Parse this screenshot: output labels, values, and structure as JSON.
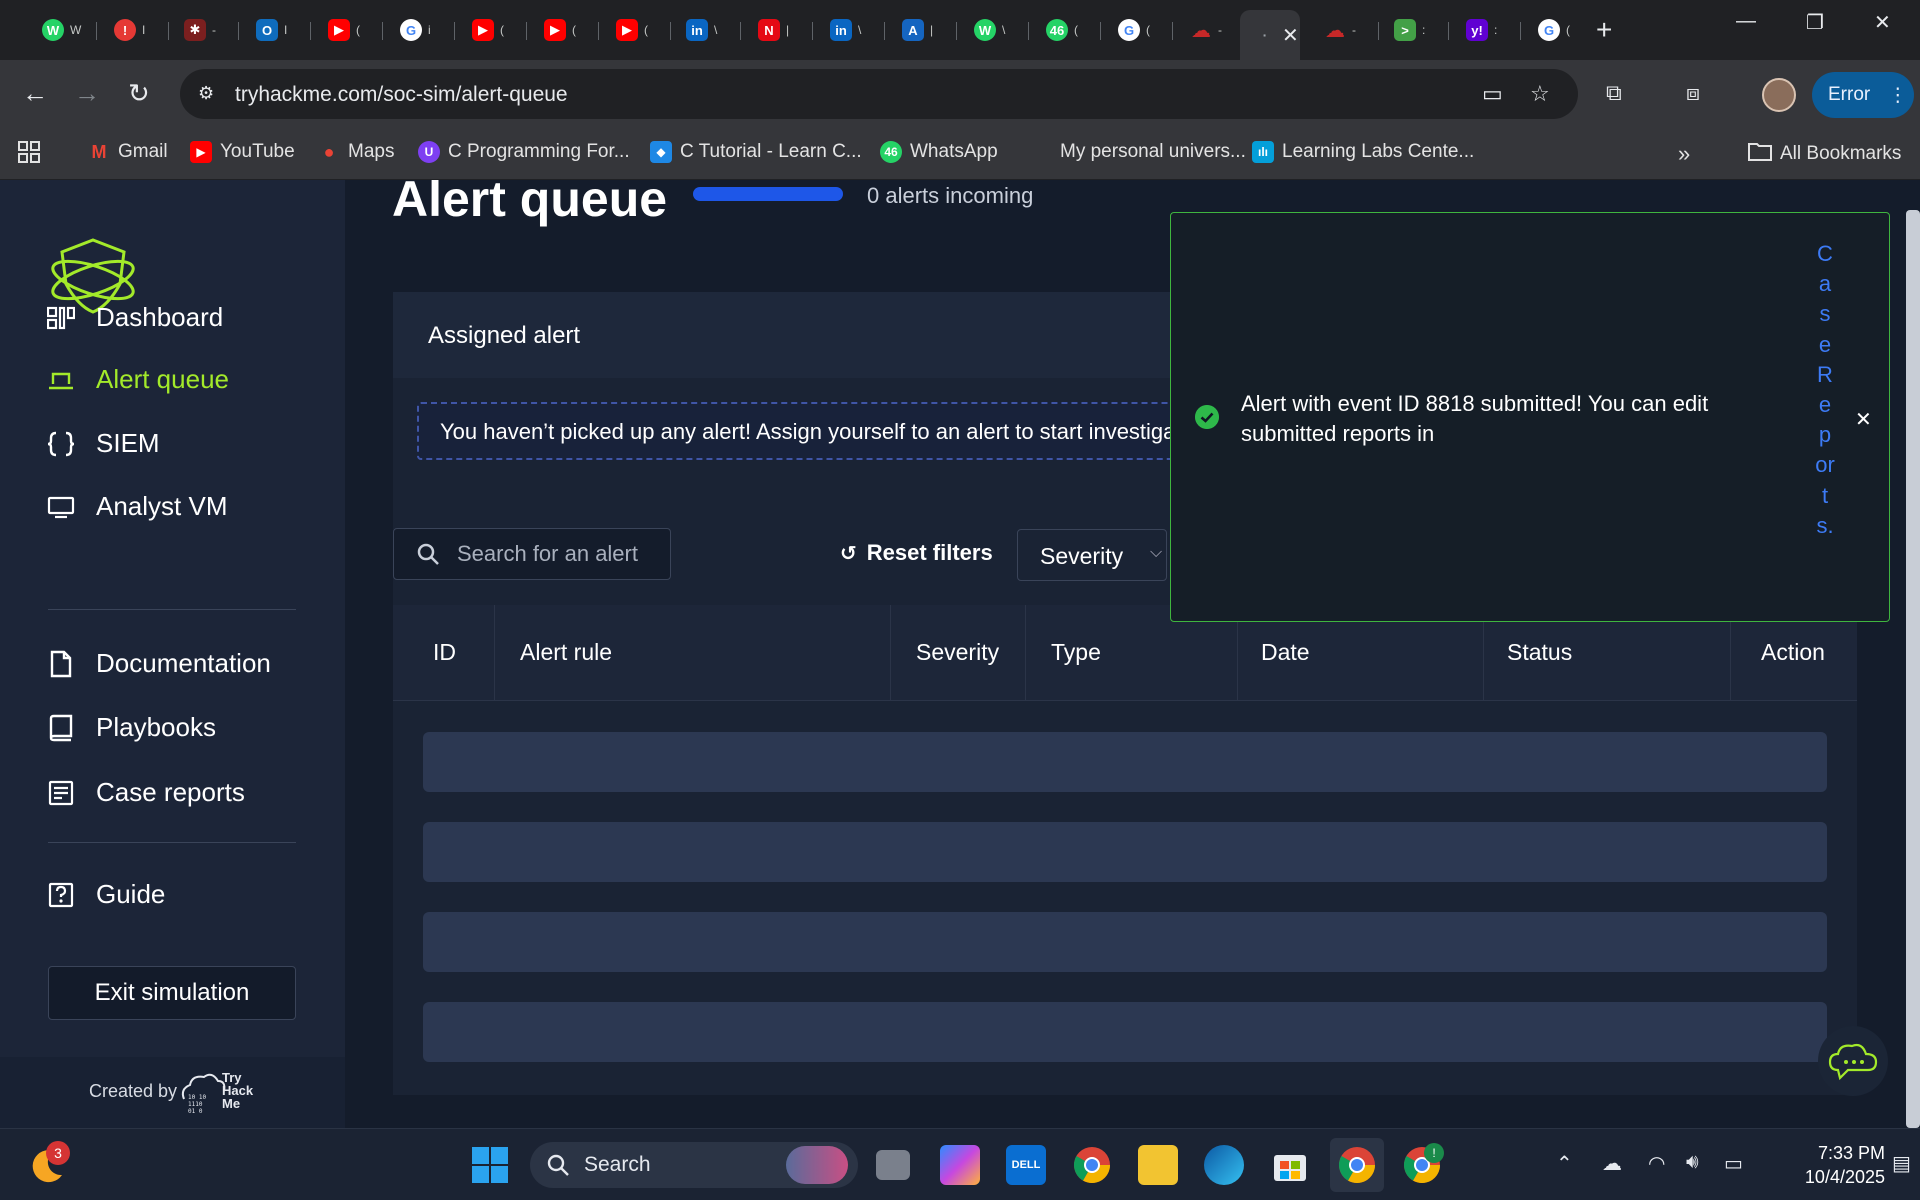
{
  "browser": {
    "url": "tryhackme.com/soc-sim/alert-queue",
    "tabs": [
      {
        "icon": "whatsapp-icon",
        "color": "#25d366",
        "glyph": "W",
        "title": "W"
      },
      {
        "icon": "alert-icon",
        "color": "#e53935",
        "glyph": "!",
        "title": "I"
      },
      {
        "icon": "bug-icon",
        "color": "#7b1f1f",
        "glyph": "✱",
        "title": "-"
      },
      {
        "icon": "outlook-icon",
        "color": "#0f6cbd",
        "glyph": "O",
        "title": "I"
      },
      {
        "icon": "youtube-icon",
        "color": "#ff0000",
        "glyph": "▶",
        "title": "("
      },
      {
        "icon": "google-icon",
        "color": "#ffffff",
        "glyph": "G",
        "title": "i"
      },
      {
        "icon": "youtube-icon",
        "color": "#ff0000",
        "glyph": "▶",
        "title": "("
      },
      {
        "icon": "youtube-icon",
        "color": "#ff0000",
        "glyph": "▶",
        "title": "("
      },
      {
        "icon": "youtube-icon",
        "color": "#ff0000",
        "glyph": "▶",
        "title": "("
      },
      {
        "icon": "linkedin-icon",
        "color": "#0a66c2",
        "glyph": "in",
        "title": "\\"
      },
      {
        "icon": "netflix-icon",
        "color": "#e50914",
        "glyph": "N",
        "title": "|"
      },
      {
        "icon": "linkedin-icon",
        "color": "#0a66c2",
        "glyph": "in",
        "title": "\\"
      },
      {
        "icon": "app-a-icon",
        "color": "#1565c0",
        "glyph": "A",
        "title": "|"
      },
      {
        "icon": "whatsapp-icon",
        "color": "#25d366",
        "glyph": "W",
        "title": "\\"
      },
      {
        "icon": "whatsapp-badge-icon",
        "color": "#25d366",
        "glyph": "46",
        "title": "("
      },
      {
        "icon": "google-icon",
        "color": "#ffffff",
        "glyph": "G",
        "title": "("
      },
      {
        "icon": "cloud-icon",
        "color": "#c62828",
        "glyph": "☁",
        "title": "-"
      },
      {
        "icon": "cloud-icon",
        "color": "#c62828",
        "glyph": "☁",
        "title": "-"
      },
      {
        "icon": "terminal-icon",
        "color": "#43a047",
        "glyph": ">",
        "title": ":"
      },
      {
        "icon": "yahoo-icon",
        "color": "#6001d2",
        "glyph": "y!",
        "title": ":"
      },
      {
        "icon": "google-icon",
        "color": "#ffffff",
        "glyph": "G",
        "title": "("
      }
    ],
    "profile_button": "Error",
    "bookmarks": [
      {
        "label": "Gmail",
        "icon": "gmail-icon",
        "color": "#ea4335",
        "glyph": "M"
      },
      {
        "label": "YouTube",
        "icon": "youtube-icon",
        "color": "#ff0000",
        "glyph": "▶"
      },
      {
        "label": "Maps",
        "icon": "maps-icon",
        "color": "#34a853",
        "glyph": "●"
      },
      {
        "label": "C Programming For...",
        "icon": "course-icon",
        "color": "#7e3ff2",
        "glyph": "U"
      },
      {
        "label": "C Tutorial - Learn C...",
        "icon": "tutorial-icon",
        "color": "#1e88e5",
        "glyph": "◆"
      },
      {
        "label": "WhatsApp",
        "icon": "whatsapp-icon",
        "color": "#25d366",
        "glyph": "46"
      },
      {
        "label": "My personal univers...",
        "icon": "blank-icon",
        "color": "transparent",
        "glyph": ""
      },
      {
        "label": "Learning Labs Cente...",
        "icon": "cisco-icon",
        "color": "#049fd9",
        "glyph": "ılı"
      }
    ],
    "all_bookmarks": "All Bookmarks"
  },
  "sidebar": {
    "items": [
      {
        "label": "Dashboard",
        "icon": "dashboard-icon",
        "active": false
      },
      {
        "label": "Alert queue",
        "icon": "alert-queue-icon",
        "active": true
      },
      {
        "label": "SIEM",
        "icon": "siem-braces-icon",
        "active": false
      },
      {
        "label": "Analyst VM",
        "icon": "monitor-icon",
        "active": false
      },
      {
        "label": "Documentation",
        "icon": "document-icon",
        "active": false
      },
      {
        "label": "Playbooks",
        "icon": "book-icon",
        "active": false
      },
      {
        "label": "Case reports",
        "icon": "report-icon",
        "active": false
      },
      {
        "label": "Guide",
        "icon": "help-icon",
        "active": false
      }
    ],
    "exit_label": "Exit simulation",
    "created_by": "Created by",
    "brand_logo_text": "Try Hack Me"
  },
  "main": {
    "title": "Alert queue",
    "incoming": "0 alerts incoming",
    "assigned_title": "Assigned alert",
    "assigned_empty": "You haven’t picked up any alert! Assign yourself to an alert to start investigating.",
    "search_placeholder": "Search for an alert",
    "reset_filters": "Reset filters",
    "severity_filter": "Severity",
    "columns": [
      "ID",
      "Alert rule",
      "Severity",
      "Type",
      "Date",
      "Status",
      "Action"
    ],
    "skeleton_rows": 4
  },
  "toast": {
    "message": "Alert with event ID 8818 submitted! You can edit submitted reports in",
    "link": "Case Reports."
  },
  "taskbar": {
    "search": "Search",
    "weather_badge": "3",
    "chrome_badge": "!",
    "time": "7:33 PM",
    "date": "10/4/2025"
  },
  "colors": {
    "accent_green": "#a3ea2a",
    "toast_border": "#3fb53f",
    "link_blue": "#3d7bf5",
    "progress_blue": "#1e57e8"
  }
}
